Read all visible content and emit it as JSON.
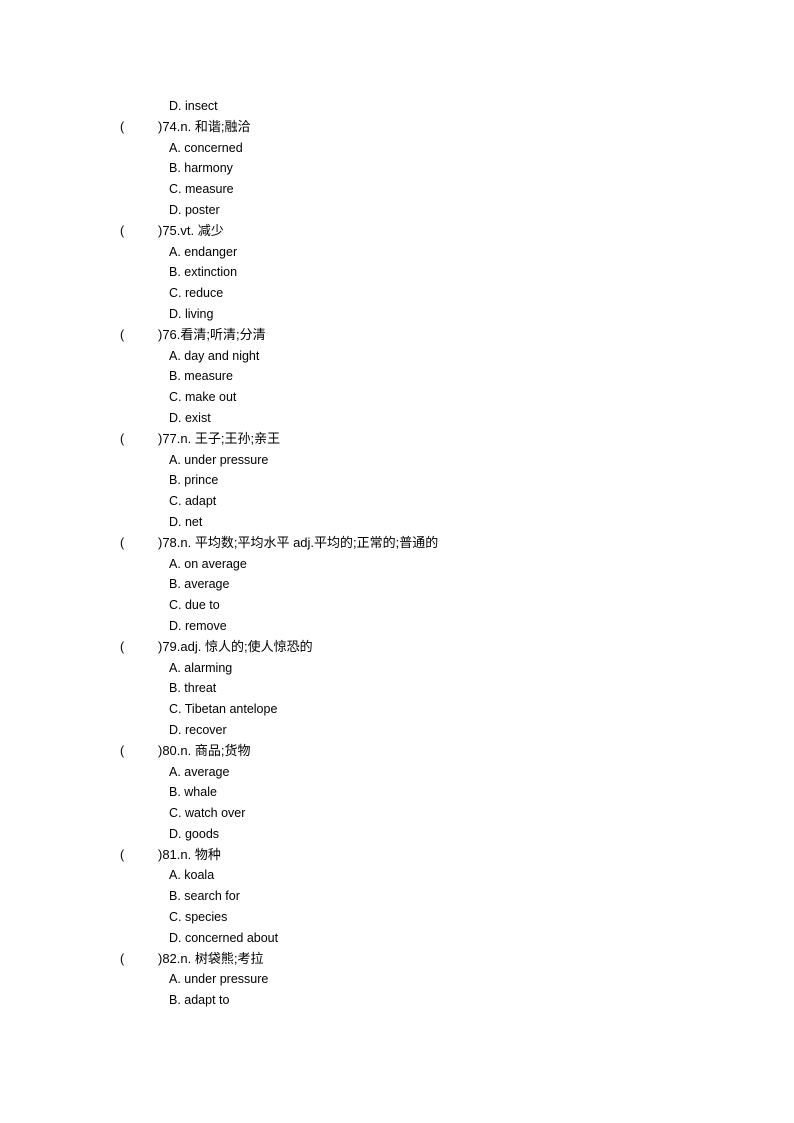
{
  "leading_options": [
    "D. insect"
  ],
  "questions": [
    {
      "paren": "(",
      "text": ")74.n.  和谐;融洽",
      "options": [
        "A. concerned",
        "B. harmony",
        "C. measure",
        "D. poster"
      ]
    },
    {
      "paren": "(",
      "text": ")75.vt.  减少",
      "options": [
        "A. endanger",
        "B. extinction",
        "C. reduce",
        "D. living"
      ]
    },
    {
      "paren": "(",
      "text": ")76.看清;听清;分清",
      "options": [
        "A. day and night",
        "B. measure",
        "C. make out",
        "D. exist"
      ]
    },
    {
      "paren": "(",
      "text": ")77.n.  王子;王孙;亲王",
      "options": [
        "A. under pressure",
        "B. prince",
        "C. adapt",
        "D. net"
      ]
    },
    {
      "paren": "(",
      "text": ")78.n.  平均数;平均水平  adj.平均的;正常的;普通的",
      "options": [
        "A. on average",
        "B. average",
        "C. due to",
        "D. remove"
      ]
    },
    {
      "paren": "(",
      "text": ")79.adj.  惊人的;使人惊恐的",
      "options": [
        "A. alarming",
        "B. threat",
        "C. Tibetan antelope",
        "D. recover"
      ]
    },
    {
      "paren": "(",
      "text": ")80.n.  商品;货物",
      "options": [
        "A. average",
        "B. whale",
        "C. watch over",
        "D. goods"
      ]
    },
    {
      "paren": "(",
      "text": ")81.n.  物种",
      "options": [
        "A. koala",
        "B. search for",
        "C. species",
        "D. concerned about"
      ]
    },
    {
      "paren": "(",
      "text": ")82.n.  树袋熊;考拉",
      "options": [
        "A. under pressure",
        "B. adapt to"
      ]
    }
  ]
}
